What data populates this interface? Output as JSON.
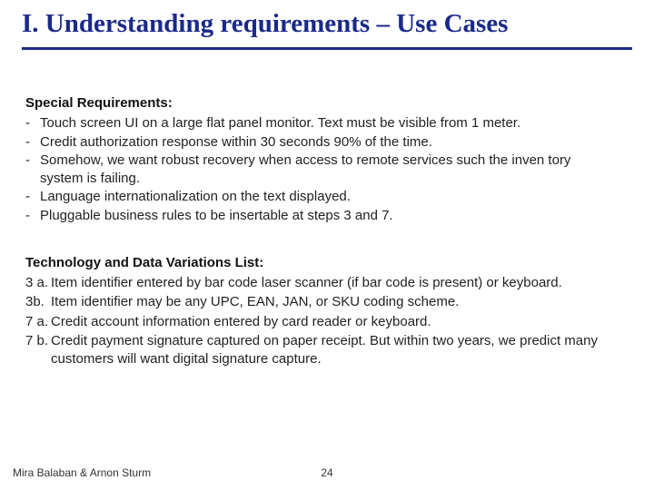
{
  "title": "I. Understanding requirements – Use Cases",
  "section1": {
    "heading": "Special Requirements:",
    "items": [
      "Touch screen UI on a large flat panel monitor. Text must be visible from 1 meter.",
      "Credit authorization response within 30 seconds 90% of the time.",
      "Somehow, we want robust recovery when access to remote services such the inven tory system is failing.",
      "Language internationalization on the text displayed.",
      "Pluggable business rules to be insertable at steps 3 and 7."
    ]
  },
  "section2": {
    "heading": "Technology and Data Variations List:",
    "items": [
      {
        "num": "3 a.",
        "text": "Item identifier entered by bar code laser scanner (if bar code is present) or keyboard."
      },
      {
        "num": "3b.",
        "text": "Item identifier may be any UPC, EAN, JAN, or SKU coding scheme."
      },
      {
        "num": "7 a.",
        "text": "Credit account information entered by card reader or keyboard."
      },
      {
        "num": "7 b.",
        "text": "Credit payment signature captured on paper receipt. But within two years, we predict many customers will want digital signature capture."
      }
    ]
  },
  "footer": {
    "authors": "Mira Balaban  &  Arnon Sturm",
    "page": "24"
  }
}
